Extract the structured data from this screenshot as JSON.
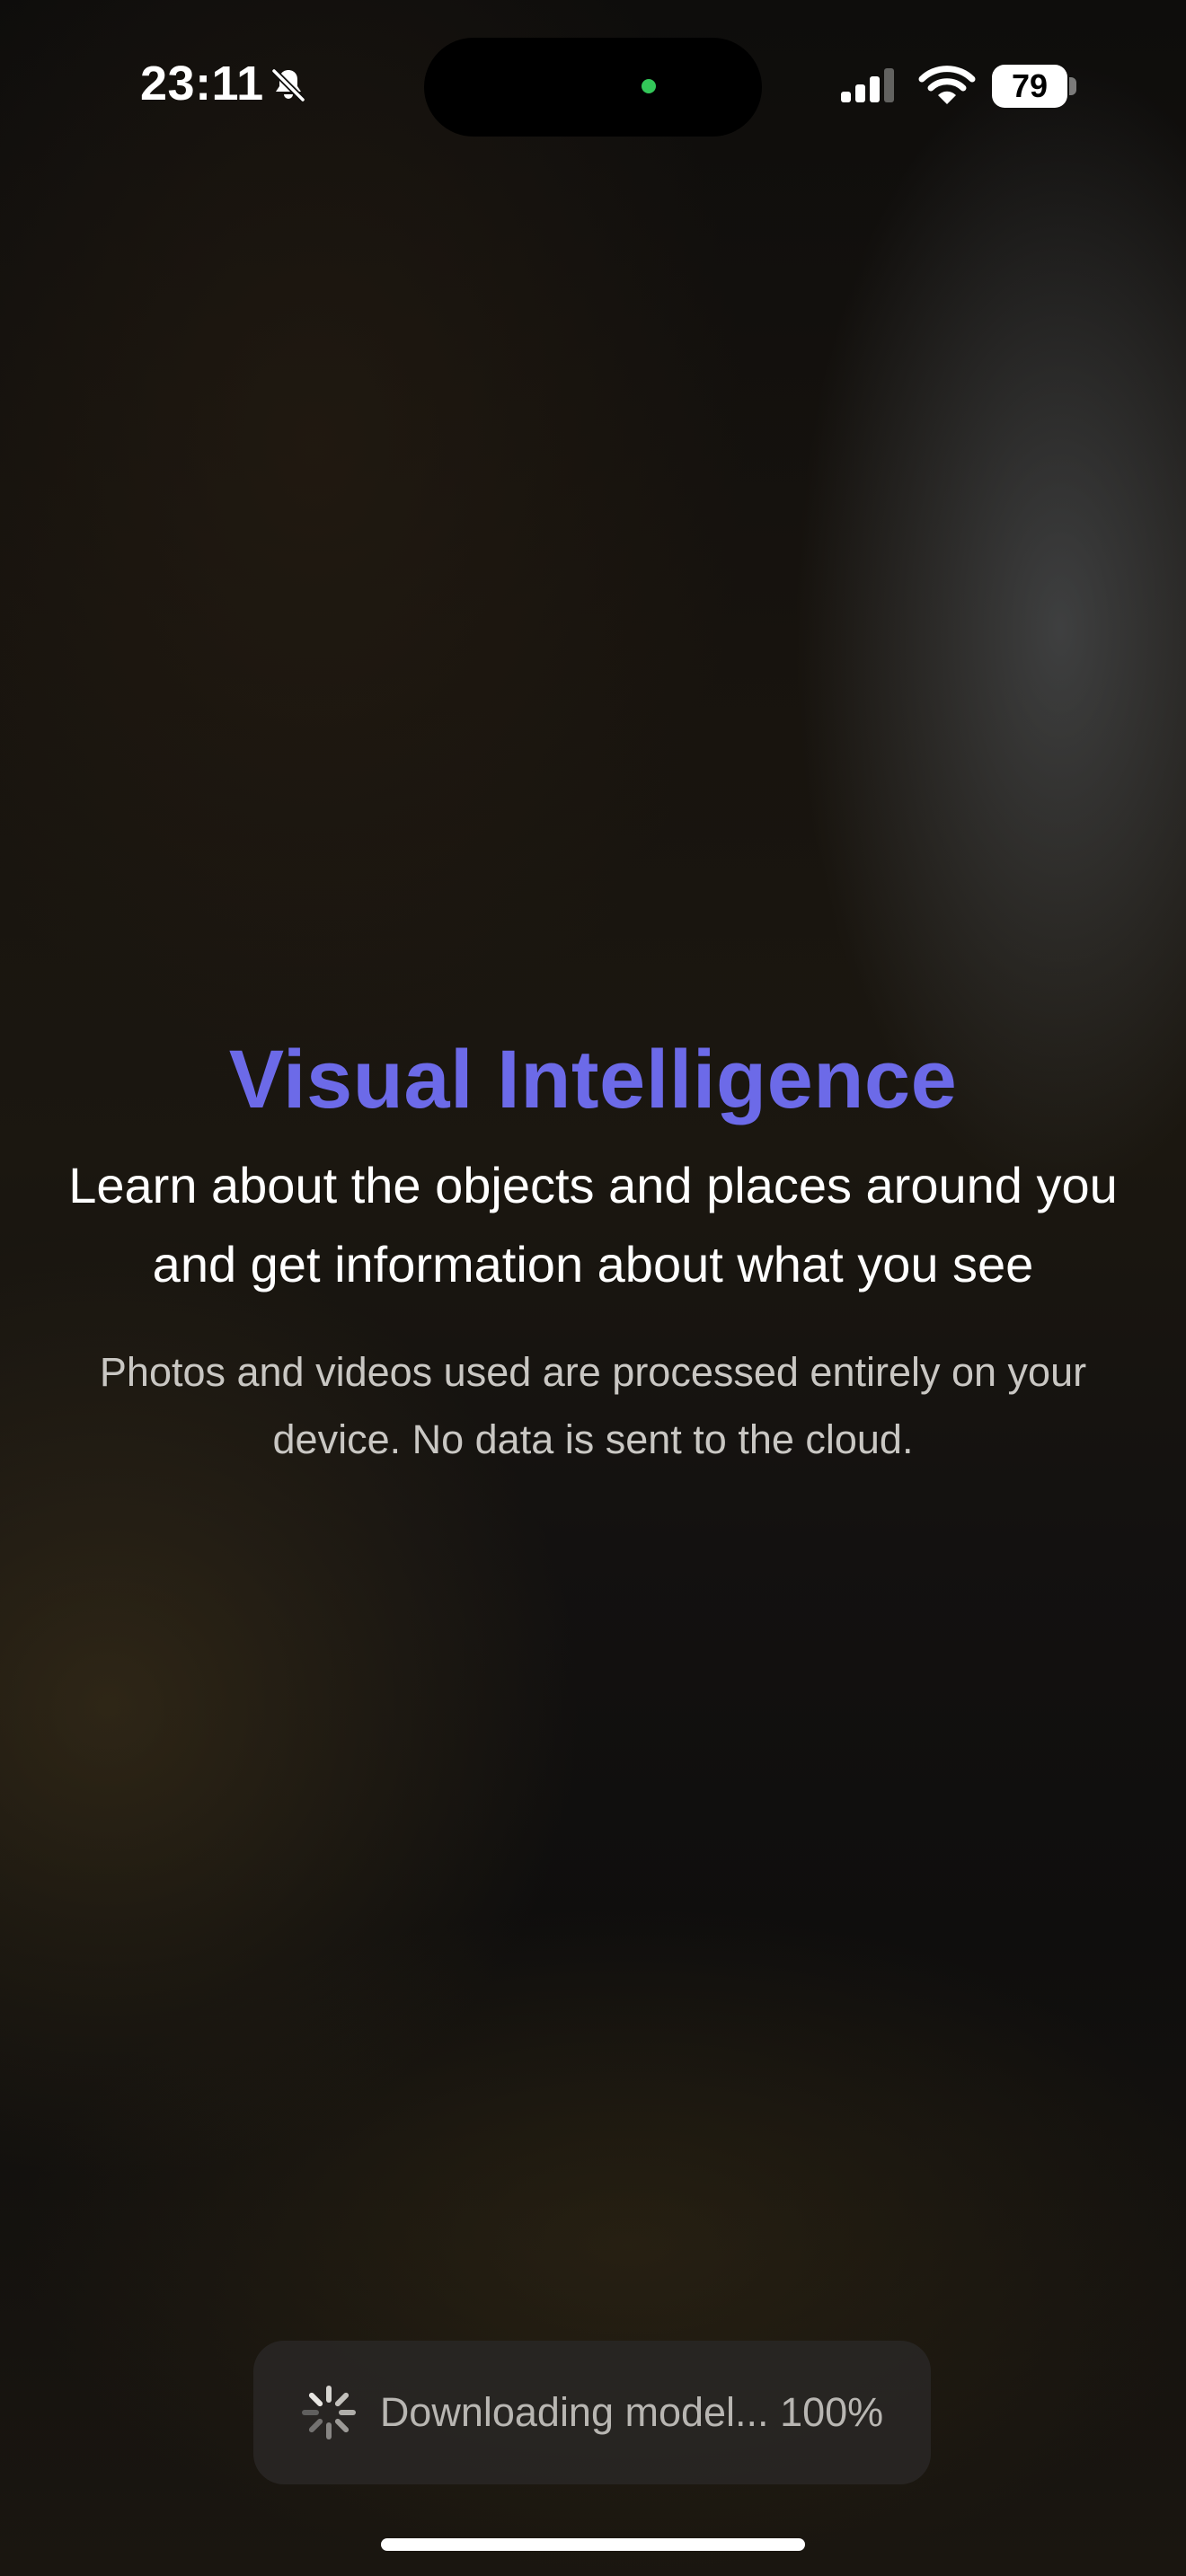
{
  "status_bar": {
    "time": "23:11",
    "battery": "79",
    "icons": [
      "bell-slash-icon",
      "cellular-signal-icon",
      "wifi-icon",
      "battery-icon"
    ]
  },
  "main": {
    "title": "Visual Intelligence",
    "subtitle": "Learn about the objects and places around you and get information about what you see",
    "privacy_note": "Photos and videos used are processed entirely on your device. No data is sent to the cloud."
  },
  "toast": {
    "icon": "loading-spinner-icon",
    "text": "Downloading model... 100%"
  },
  "colors": {
    "title_accent": "#6c6ae8",
    "dynamic_island_indicator": "#33c759"
  }
}
